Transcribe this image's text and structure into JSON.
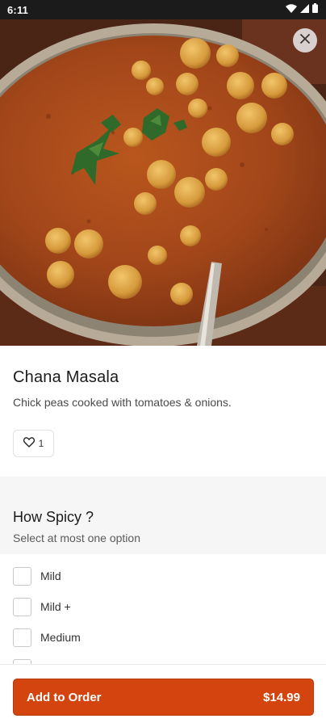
{
  "status_bar": {
    "time": "6:11",
    "icons": [
      "wifi-icon",
      "signal-icon",
      "battery-icon"
    ]
  },
  "hero": {
    "close_icon": "close-icon"
  },
  "item": {
    "title": "Chana Masala",
    "description": "Chick peas cooked with tomatoes & onions.",
    "like_count": "1"
  },
  "option_group": {
    "title": "How Spicy ?",
    "subtitle": "Select at most one option",
    "options": [
      {
        "label": "Mild",
        "checked": false
      },
      {
        "label": "Mild +",
        "checked": false
      },
      {
        "label": "Medium",
        "checked": false
      }
    ]
  },
  "bottom_bar": {
    "button_label": "Add to Order",
    "price": "$14.99"
  },
  "colors": {
    "accent": "#d4440e",
    "status_bar": "#1b1b1b",
    "section_bg": "#f6f6f6"
  }
}
